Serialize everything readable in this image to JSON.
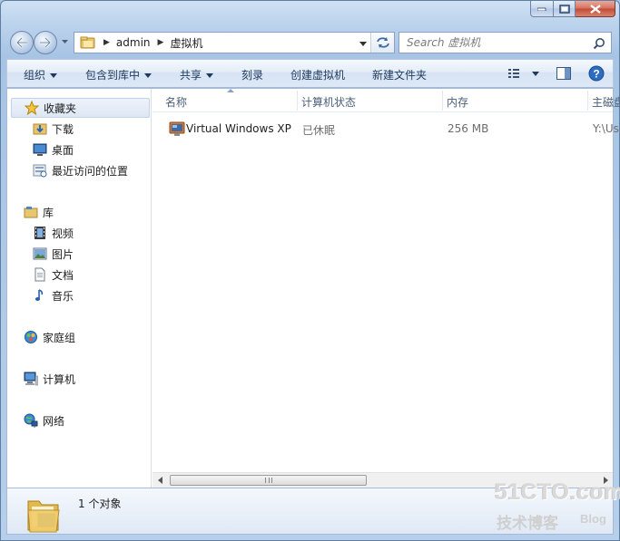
{
  "window": {
    "caption_buttons": [
      "minimize",
      "maximize",
      "close"
    ]
  },
  "navbar": {
    "address": {
      "root_icon": "folder-icon",
      "segments": [
        "admin",
        "虚拟机"
      ]
    },
    "search": {
      "placeholder": "Search 虚拟机"
    }
  },
  "toolbar": {
    "items": [
      {
        "label": "组织",
        "dropdown": true
      },
      {
        "label": "包含到库中",
        "dropdown": true
      },
      {
        "label": "共享",
        "dropdown": true
      },
      {
        "label": "刻录",
        "dropdown": false
      },
      {
        "label": "创建虚拟机",
        "dropdown": false
      },
      {
        "label": "新建文件夹",
        "dropdown": false
      }
    ],
    "icons": [
      "view-options-icon",
      "preview-pane-icon",
      "help-icon"
    ]
  },
  "sidebar": {
    "favorites": {
      "label": "收藏夹",
      "items": [
        "下载",
        "桌面",
        "最近访问的位置"
      ]
    },
    "libraries": {
      "label": "库",
      "items": [
        "视频",
        "图片",
        "文档",
        "音乐"
      ]
    },
    "homegroup": "家庭组",
    "computer": "计算机",
    "network": "网络"
  },
  "list": {
    "columns": [
      "名称",
      "计算机状态",
      "内存",
      "主磁盘"
    ],
    "rows": [
      {
        "name": "Virtual Windows XP",
        "state": "已休眠",
        "memory": "256 MB",
        "disk": "Y:\\Us"
      }
    ]
  },
  "details": {
    "count": "1 个对象"
  },
  "watermark": {
    "site": "51CTO.com",
    "tag": "技术博客",
    "blog": "Blog"
  },
  "colors": {
    "accent": "#1e395b",
    "selection": "#dde7f4",
    "frame": "#b9d1ec"
  }
}
